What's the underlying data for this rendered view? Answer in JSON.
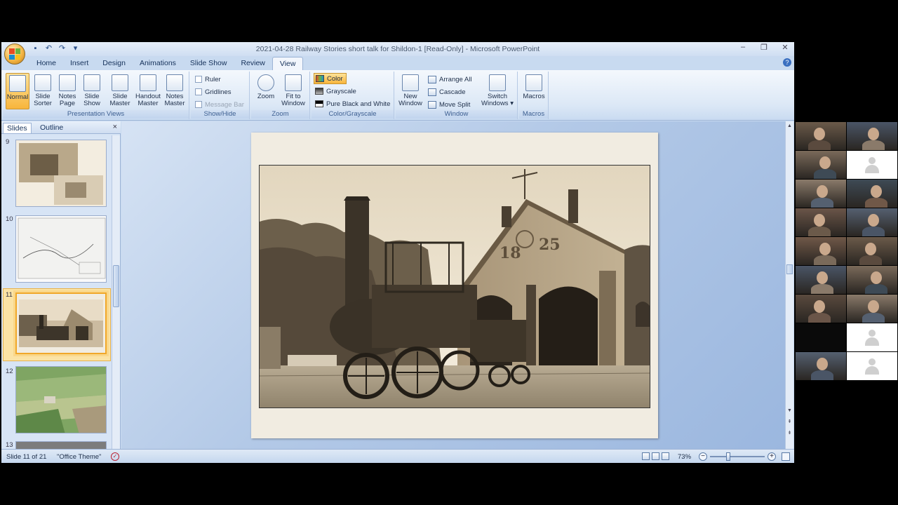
{
  "window": {
    "title": "2021-04-28 Railway Stories short talk for Shildon-1 [Read-Only] - Microsoft PowerPoint",
    "controls": [
      "–",
      "❐",
      "✕"
    ]
  },
  "ribbon_tabs": [
    {
      "label": "Home"
    },
    {
      "label": "Insert"
    },
    {
      "label": "Design"
    },
    {
      "label": "Animations"
    },
    {
      "label": "Slide Show"
    },
    {
      "label": "Review"
    },
    {
      "label": "View",
      "active": true
    }
  ],
  "ribbon": {
    "presentation_views": {
      "label": "Presentation Views",
      "buttons": [
        {
          "line1": "Normal",
          "line2": "",
          "selected": true
        },
        {
          "line1": "Slide",
          "line2": "Sorter"
        },
        {
          "line1": "Notes",
          "line2": "Page"
        },
        {
          "line1": "Slide",
          "line2": "Show"
        },
        {
          "line1": "Slide",
          "line2": "Master"
        },
        {
          "line1": "Handout",
          "line2": "Master"
        },
        {
          "line1": "Notes",
          "line2": "Master"
        }
      ]
    },
    "show_hide": {
      "label": "Show/Hide",
      "items": [
        "Ruler",
        "Gridlines",
        "Message Bar"
      ]
    },
    "zoom": {
      "label": "Zoom",
      "buttons": [
        {
          "line1": "Zoom",
          "line2": ""
        },
        {
          "line1": "Fit to",
          "line2": "Window"
        }
      ]
    },
    "color_grayscale": {
      "label": "Color/Grayscale",
      "items": [
        "Color",
        "Grayscale",
        "Pure Black and White"
      ]
    },
    "window": {
      "label": "Window",
      "new_window": {
        "line1": "New",
        "line2": "Window"
      },
      "items": [
        "Arrange All",
        "Cascade",
        "Move Split"
      ],
      "switch_windows": {
        "line1": "Switch",
        "line2": "Windows ▾"
      }
    },
    "macros": {
      "label": "Macros",
      "button": {
        "line1": "Macros",
        "line2": ""
      }
    }
  },
  "slide_panel": {
    "tabs": [
      "Slides",
      "Outline"
    ],
    "close": "×",
    "thumbnails": [
      {
        "num": "9"
      },
      {
        "num": "10"
      },
      {
        "num": "11",
        "active": true
      },
      {
        "num": "12"
      },
      {
        "num": "13"
      }
    ]
  },
  "slide": {
    "date_numbers_left": "18",
    "date_numbers_right": "25"
  },
  "status_bar": {
    "slide_info": "Slide 11 of 21",
    "theme": "\"Office Theme\"",
    "zoom": "73%",
    "zoom_level": 0.73
  },
  "colors": {
    "ribbon_accent": "#f8b53c",
    "sepia_dark": "#3a3226",
    "sepia_light": "#efe4cf",
    "slide_bg": "#f1ece1"
  },
  "gallery": {
    "tile_count": 18
  }
}
